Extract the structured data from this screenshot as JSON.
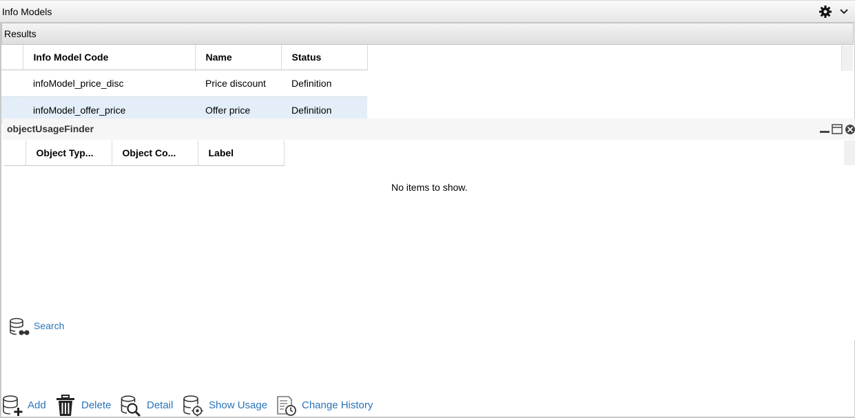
{
  "window": {
    "title": "Info Models",
    "settings_icon": "gear-icon",
    "collapse_icon": "chevron-down-icon"
  },
  "results": {
    "title": "Results",
    "columns": [
      "Info Model Code",
      "Name",
      "Status"
    ],
    "rows": [
      {
        "code": "infoModel_price_disc",
        "name": "Price discount",
        "status": "Definition"
      },
      {
        "code": "infoModel_offer_price",
        "name": "Offer price",
        "status": "Definition"
      }
    ],
    "selected_row": 1
  },
  "usage_panel": {
    "title": "objectUsageFinder",
    "columns": [
      "Object Typ...",
      "Object Co...",
      "Label"
    ],
    "empty_text": "No items to show.",
    "search_label": "Search"
  },
  "toolbar": {
    "add_label": "Add",
    "delete_label": "Delete",
    "detail_label": "Detail",
    "show_usage_label": "Show Usage",
    "change_history_label": "Change History"
  },
  "colors": {
    "link": "#2a73b8",
    "selected_row": "#e3eef8"
  }
}
